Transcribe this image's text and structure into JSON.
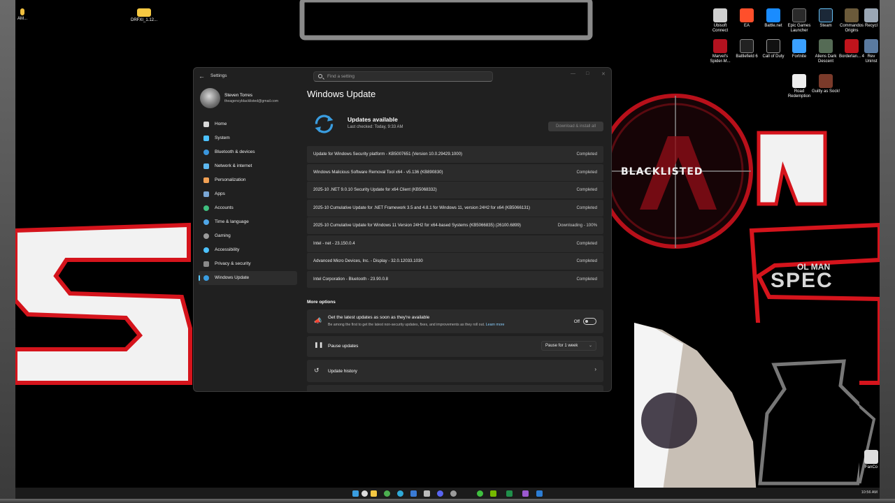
{
  "desktop": {
    "logo_text": "BLACKLISTED",
    "watermark_small": "OL MAN",
    "watermark_big": "SPEC",
    "icons": [
      {
        "label": "Ubisoft Connect",
        "icon": "ubisoft-icon",
        "color": "#cfcfcf"
      },
      {
        "label": "EA",
        "icon": "ea-icon",
        "color": "#ff4f2b"
      },
      {
        "label": "Battle.net",
        "icon": "battlenet-icon",
        "color": "#1a8cff"
      },
      {
        "label": "Epic Games Launcher",
        "icon": "epic-icon",
        "color": "#2a2a2a"
      },
      {
        "label": "Steam",
        "icon": "steam-icon",
        "color": "#1b2838"
      },
      {
        "label": "Commandos Origins",
        "icon": "commandos-icon",
        "color": "#6b5a3a"
      },
      {
        "label": "Recycl",
        "icon": "recycle-bin-icon",
        "color": "#9aa7b5"
      },
      {
        "label": "Marvel's Spider-M...",
        "icon": "spiderman-icon",
        "color": "#b3121f"
      },
      {
        "label": "Battlefield 6",
        "icon": "battlefield-icon",
        "color": "#222"
      },
      {
        "label": "Call of Duty",
        "icon": "cod-icon",
        "color": "#111"
      },
      {
        "label": "Fortnite",
        "icon": "fortnite-icon",
        "color": "#3aa0ff"
      },
      {
        "label": "Aliens Dark Descent",
        "icon": "aliens-icon",
        "color": "#556b55"
      },
      {
        "label": "Borderlan... 4",
        "icon": "borderlands-icon",
        "color": "#c0141c"
      },
      {
        "label": "Rev Uninst",
        "icon": "revo-icon",
        "color": "#5a7aa0"
      },
      {
        "label": "Road Redemption",
        "icon": "road-redemption-icon",
        "color": "#eee"
      },
      {
        "label": "Guilty as Sock!",
        "icon": "guilty-sock-icon",
        "color": "#7a3a2a"
      },
      {
        "label": "AM...",
        "icon": "amd-icon",
        "color": "#f0c040"
      },
      {
        "label": "DRFXI_1.12...",
        "icon": "folder-icon",
        "color": "#f5c842"
      },
      {
        "label": "FanCo",
        "icon": "fancontrol-icon",
        "color": "#ddd"
      }
    ]
  },
  "settings": {
    "app_title": "Settings",
    "search_placeholder": "Find a setting",
    "user": {
      "name": "Steven Torres",
      "email": "theagencyblacklisted@gmail.com"
    },
    "nav": [
      {
        "label": "Home",
        "icon": "home-icon",
        "color": "#d9d9d9"
      },
      {
        "label": "System",
        "icon": "system-icon",
        "color": "#4cc2ff"
      },
      {
        "label": "Bluetooth & devices",
        "icon": "bluetooth-icon",
        "color": "#3a96dd"
      },
      {
        "label": "Network & internet",
        "icon": "network-icon",
        "color": "#5db8f0"
      },
      {
        "label": "Personalization",
        "icon": "brush-icon",
        "color": "#f2a154"
      },
      {
        "label": "Apps",
        "icon": "apps-icon",
        "color": "#7aa7d6"
      },
      {
        "label": "Accounts",
        "icon": "accounts-icon",
        "color": "#3fbf7f"
      },
      {
        "label": "Time & language",
        "icon": "clock-globe-icon",
        "color": "#4fa6e8"
      },
      {
        "label": "Gaming",
        "icon": "gaming-icon",
        "color": "#9a9a9a"
      },
      {
        "label": "Accessibility",
        "icon": "accessibility-icon",
        "color": "#4cc2ff"
      },
      {
        "label": "Privacy & security",
        "icon": "shield-icon",
        "color": "#8a8a8a"
      },
      {
        "label": "Windows Update",
        "icon": "update-icon",
        "color": "#3a9de0",
        "active": true
      }
    ],
    "page_title": "Windows Update",
    "status": {
      "title": "Updates available",
      "subtitle": "Last checked: Today, 9:33 AM",
      "action": "Download & install all",
      "accent": "#3a9de0"
    },
    "updates": [
      {
        "name": "Update for Windows Security platform - KB5007651 (Version 10.0.29429.1000)",
        "status": "Completed"
      },
      {
        "name": "Windows Malicious Software Removal Tool x64 - v5.136 (KB890830)",
        "status": "Completed"
      },
      {
        "name": "2025-10 .NET 9.0.10 Security Update for x64 Client (KB5068332)",
        "status": "Completed"
      },
      {
        "name": "2025-10 Cumulative Update for .NET Framework 3.5 and 4.8.1 for Windows 11, version 24H2 for x64 (KB5066131)",
        "status": "Completed"
      },
      {
        "name": "2025-10 Cumulative Update for Windows 11 Version 24H2 for x64-based Systems (KB5066835) (26100.6899)",
        "status": "Downloading - 100%"
      },
      {
        "name": "Intel - net - 23.150.0.4",
        "status": "Completed"
      },
      {
        "name": "Advanced Micro Devices, Inc. - Display - 32.0.12033.1030",
        "status": "Completed"
      },
      {
        "name": "Intel Corporation - Bluetooth - 23.90.0.8",
        "status": "Completed"
      }
    ],
    "more_options_label": "More options",
    "latest_updates": {
      "title": "Get the latest updates as soon as they're available",
      "desc": "Be among the first to get the latest non-security updates, fixes, and improvements as they roll out.",
      "learn_more": "Learn more",
      "state": "Off"
    },
    "pause": {
      "title": "Pause updates",
      "value": "Pause for 1 week"
    },
    "history": {
      "title": "Update history"
    }
  },
  "taskbar": {
    "time": "10:56 AM",
    "apps": [
      {
        "icon": "start-icon",
        "color": "#3a9de0"
      },
      {
        "icon": "search-icon",
        "color": "#dddddd"
      },
      {
        "icon": "file-explorer-icon",
        "color": "#f5c842"
      },
      {
        "icon": "chrome-icon",
        "color": "#4caf50"
      },
      {
        "icon": "edge-icon",
        "color": "#2fa9d8"
      },
      {
        "icon": "store-icon",
        "color": "#3a7bd5"
      },
      {
        "icon": "pen-icon",
        "color": "#bbbbbb"
      },
      {
        "icon": "discord-icon",
        "color": "#5865f2"
      },
      {
        "icon": "settings-icon",
        "color": "#9a9a9a"
      },
      {
        "icon": "xbox-icon",
        "color": "#3fbf3f"
      },
      {
        "icon": "nvidia-icon",
        "color": "#76b900"
      },
      {
        "icon": "excel-icon",
        "color": "#1f8f4a"
      },
      {
        "icon": "visual-studio-icon",
        "color": "#9b59d0"
      },
      {
        "icon": "outlook-icon",
        "color": "#2b7cd3"
      }
    ]
  }
}
